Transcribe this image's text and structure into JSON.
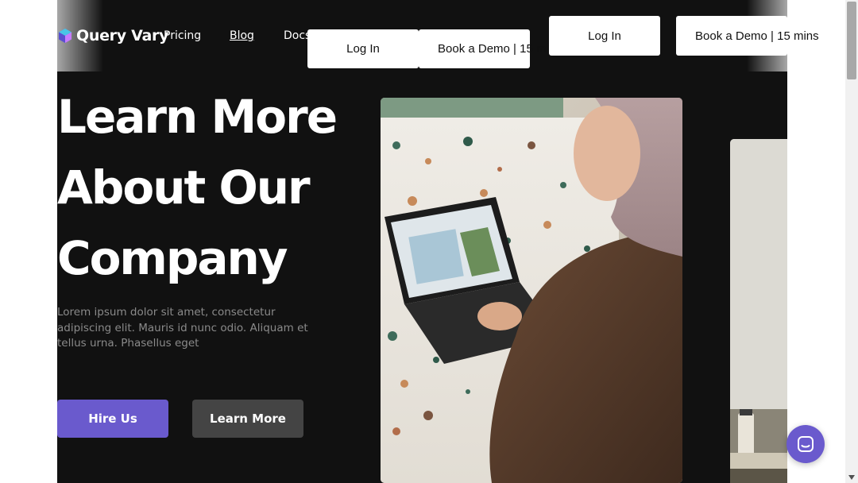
{
  "brand": {
    "name": "Query Vary",
    "logo_icon": "query-vary-logo-icon"
  },
  "nav": {
    "links": [
      "Pricing",
      "Blog",
      "Docs"
    ]
  },
  "header_buttons": {
    "login_label": "Log In",
    "demo_label": "Book a Demo | 15 mins"
  },
  "hero": {
    "headline": [
      "Learn More",
      "About Our",
      "Company"
    ],
    "description": "Lorem ipsum dolor sit amet, consectetur adipiscing elit. Mauris id nunc odio. Aliquam et tellus urna. Phasellus eget",
    "primary_cta": "Hire Us",
    "secondary_cta": "Learn More"
  },
  "images": {
    "main_photo": "woman-using-laptop-photo",
    "second_photo": "office-desk-photo"
  },
  "chat": {
    "icon": "chat-bubble-icon"
  },
  "colors": {
    "hero_background": "#111111",
    "accent": "#6a5acd",
    "secondary_button": "#444444",
    "text_light": "#ffffff",
    "text_muted": "#8a8a8a"
  }
}
